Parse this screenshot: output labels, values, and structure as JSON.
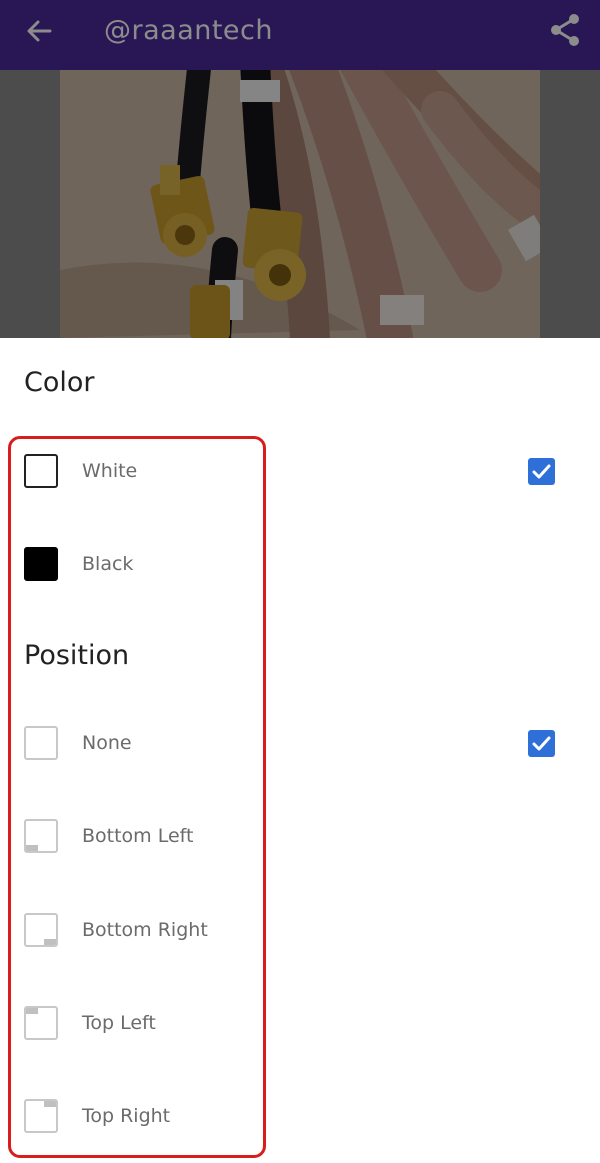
{
  "appbar": {
    "title": "@raaantech",
    "back_icon": "arrow-left-icon",
    "share_icon": "share-icon"
  },
  "preview": {
    "alt": "photo of coaxial cables with gold SMA connectors"
  },
  "color_section": {
    "title": "Color",
    "options": [
      {
        "label": "White",
        "checked": true
      },
      {
        "label": "Black",
        "checked": false
      }
    ]
  },
  "position_section": {
    "title": "Position",
    "options": [
      {
        "label": "None",
        "checked": true
      },
      {
        "label": "Bottom Left",
        "checked": false
      },
      {
        "label": "Bottom Right",
        "checked": false
      },
      {
        "label": "Top Left",
        "checked": false
      },
      {
        "label": "Top Right",
        "checked": false
      }
    ]
  },
  "colors": {
    "appbar": "#4a2a9a",
    "checkbox": "#2f6fd8",
    "highlight": "#d91d1d"
  }
}
